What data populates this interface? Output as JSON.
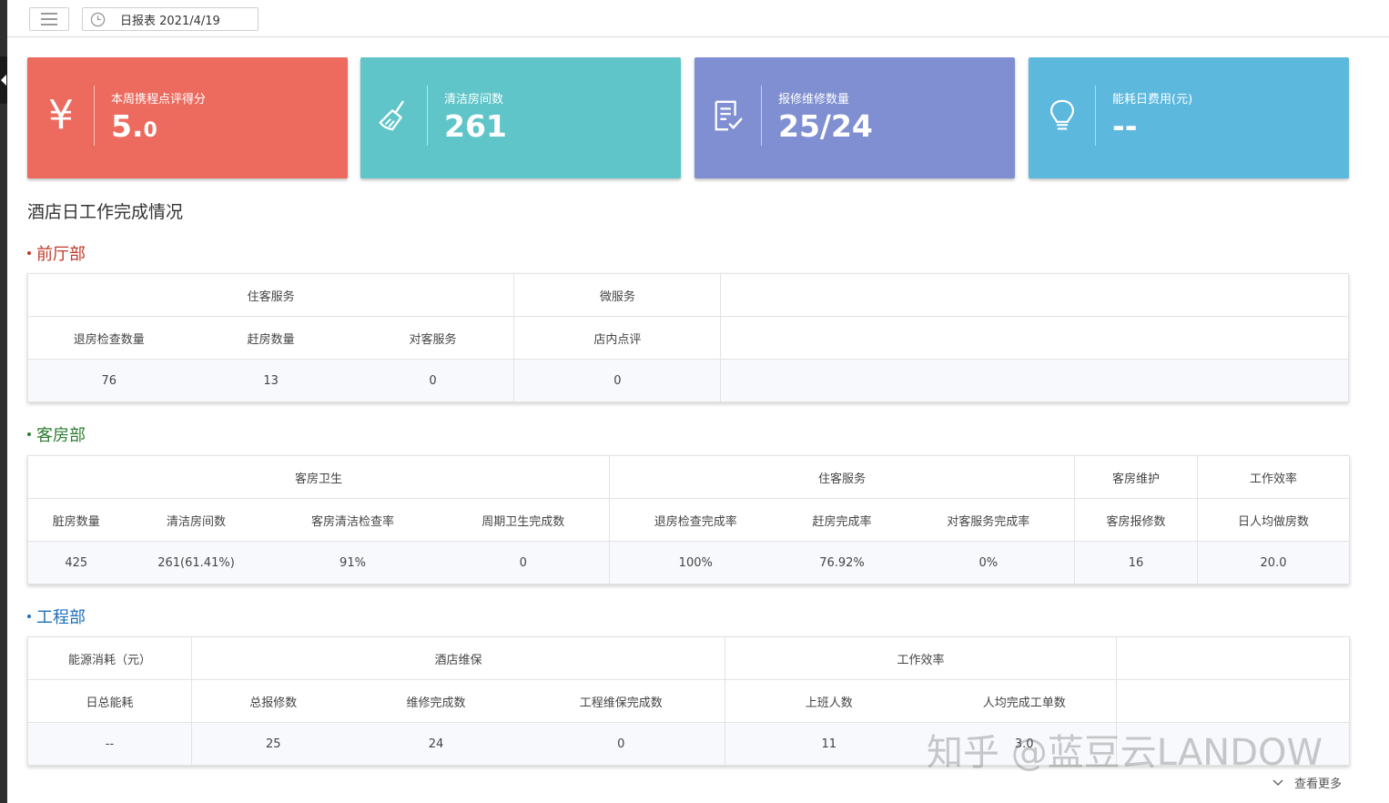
{
  "topbar": {
    "menu_icon": "hamburger-icon",
    "date_icon": "clock-icon",
    "date_label": "日报表 2021/4/19"
  },
  "cards": [
    {
      "icon": "yen-icon",
      "label": "本周携程点评得分",
      "value_main": "5.",
      "value_small": "0",
      "color": "#ec6a5e"
    },
    {
      "icon": "broom-icon",
      "label": "清洁房间数",
      "value_main": "261",
      "value_small": "",
      "color": "#5fc5c8"
    },
    {
      "icon": "checklist-icon",
      "label": "报修维修数量",
      "value_main": "25/24",
      "value_small": "",
      "color": "#7f8fd1"
    },
    {
      "icon": "lightbulb-icon",
      "label": "能耗日费用(元)",
      "value_main": "--",
      "value_small": "",
      "color": "#5cb8dc"
    }
  ],
  "section_title": "酒店日工作完成情况",
  "departments": {
    "front": {
      "title": "前厅部",
      "color": "#c0392b",
      "groups": [
        "住客服务",
        "微服务"
      ],
      "headers": [
        "退房检查数量",
        "赶房数量",
        "对客服务",
        "店内点评"
      ],
      "values": [
        "76",
        "13",
        "0",
        "0"
      ]
    },
    "housekeeping": {
      "title": "客房部",
      "color": "#2e7d32",
      "groups": [
        "客房卫生",
        "住客服务",
        "客房维护",
        "工作效率"
      ],
      "headers": [
        "脏房数量",
        "清洁房间数",
        "客房清洁检查率",
        "周期卫生完成数",
        "退房检查完成率",
        "赶房完成率",
        "对客服务完成率",
        "客房报修数",
        "日人均做房数"
      ],
      "values": [
        "425",
        "261(61.41%)",
        "91%",
        "0",
        "100%",
        "76.92%",
        "0%",
        "16",
        "20.0"
      ]
    },
    "engineering": {
      "title": "工程部",
      "color": "#1e6fb8",
      "groups": [
        "能源消耗（元）",
        "酒店维保",
        "工作效率"
      ],
      "headers": [
        "日总能耗",
        "总报修数",
        "维修完成数",
        "工程维保完成数",
        "上班人数",
        "人均完成工单数"
      ],
      "values": [
        "--",
        "25",
        "24",
        "0",
        "11",
        "3.0"
      ]
    }
  },
  "more_label": "查看更多",
  "watermark": "知乎 @蓝豆云LANDOW"
}
